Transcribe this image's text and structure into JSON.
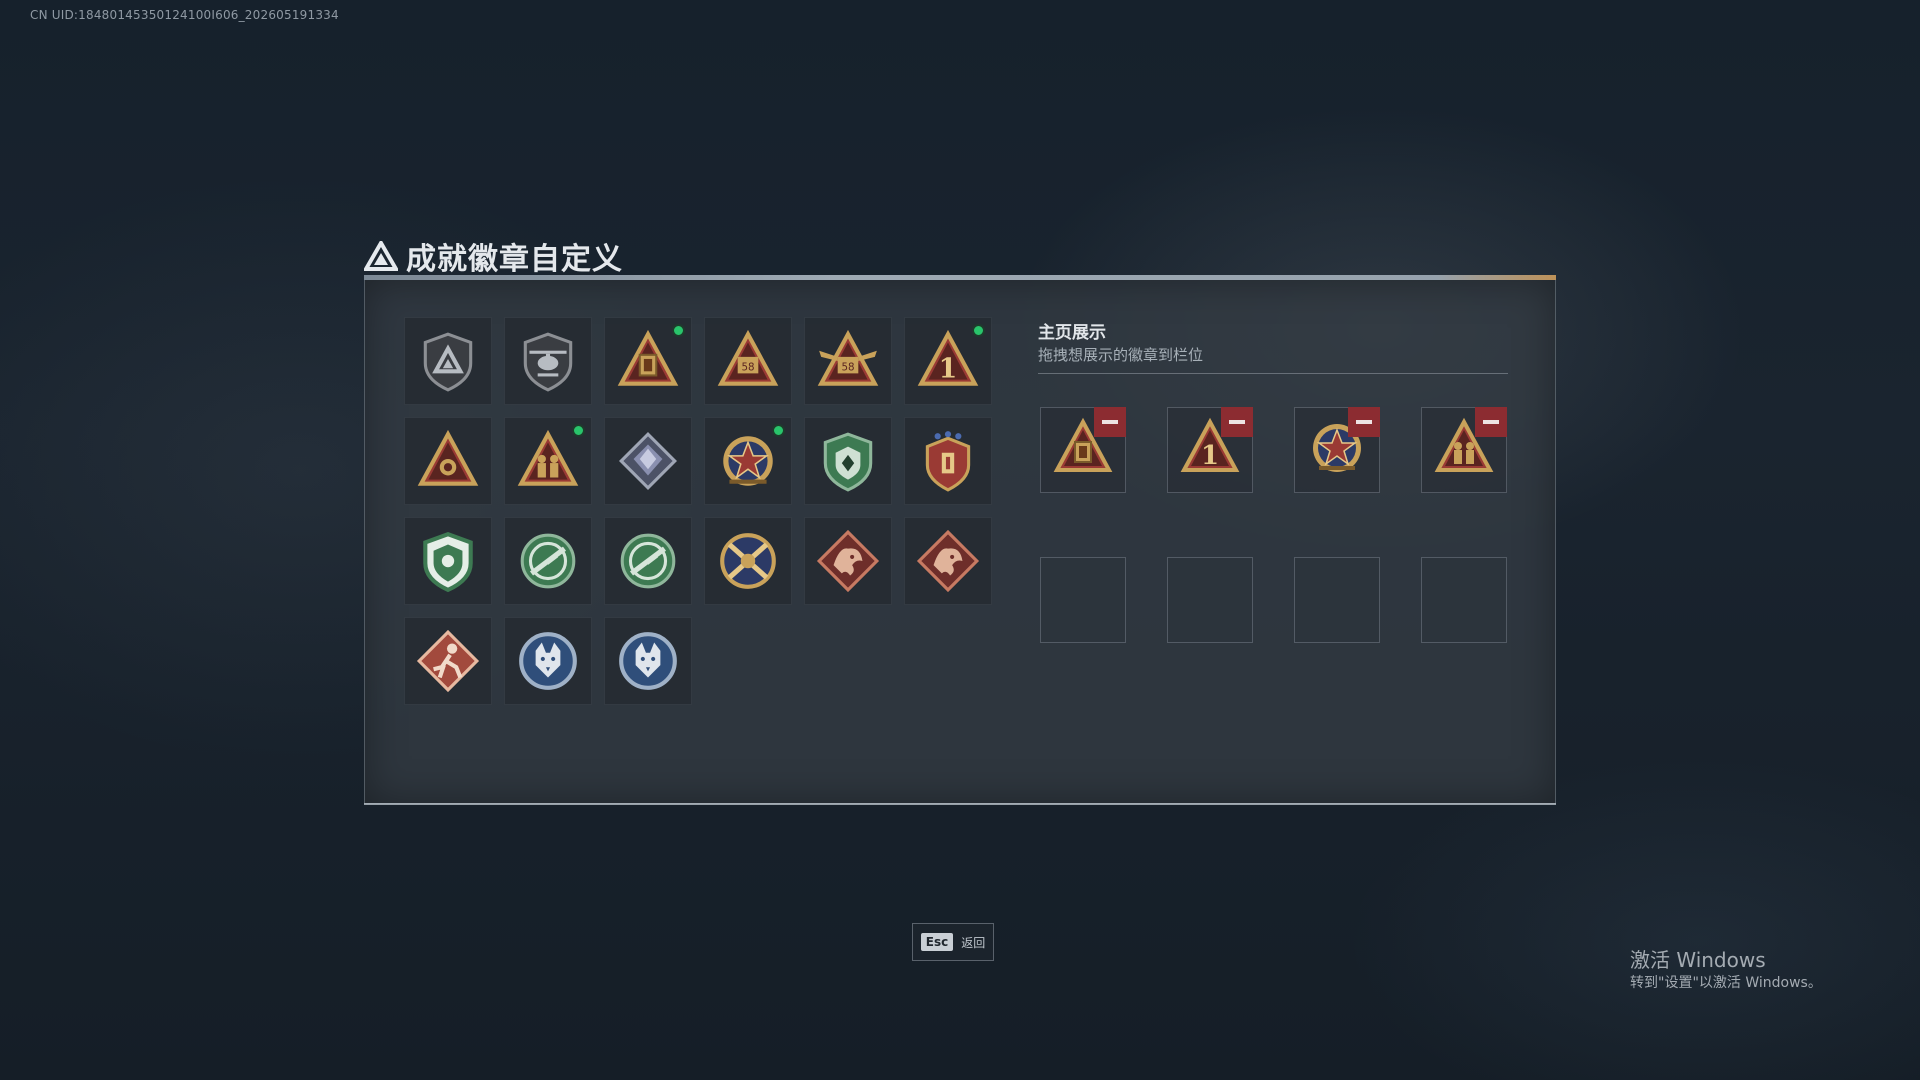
{
  "uid_text": "CN UID:18480145350124100I606_202605191334",
  "dialog": {
    "title": "成就徽章自定义",
    "title_icon": "tri-logo-icon"
  },
  "badges": [
    {
      "name": "badge-shield-delta",
      "new": false
    },
    {
      "name": "badge-helicopter",
      "new": false
    },
    {
      "name": "badge-gold-lantern",
      "new": true
    },
    {
      "name": "badge-gold-58",
      "new": false
    },
    {
      "name": "badge-gold-winged-58",
      "new": false
    },
    {
      "name": "badge-gold-one",
      "new": true
    },
    {
      "name": "badge-gold-gem",
      "new": false
    },
    {
      "name": "badge-gold-soldiers",
      "new": true
    },
    {
      "name": "badge-silver-diamond",
      "new": false
    },
    {
      "name": "badge-red-star-medal",
      "new": true
    },
    {
      "name": "badge-green-shield",
      "new": false
    },
    {
      "name": "badge-red-eagle-shield",
      "new": false
    },
    {
      "name": "badge-green-armor",
      "new": false
    },
    {
      "name": "badge-green-rifle-1",
      "new": false
    },
    {
      "name": "badge-green-rifle-2",
      "new": false
    },
    {
      "name": "badge-gold-cross-rifle",
      "new": false
    },
    {
      "name": "badge-red-dragon-1",
      "new": false
    },
    {
      "name": "badge-red-dragon-2",
      "new": false
    },
    {
      "name": "badge-red-runner",
      "new": false
    },
    {
      "name": "badge-wolf-1",
      "new": false
    },
    {
      "name": "badge-wolf-2",
      "new": false
    }
  ],
  "home_display": {
    "title": "主页展示",
    "subtitle": "拖拽想展示的徽章到栏位",
    "slots": [
      "badge-gold-lantern",
      "badge-gold-one",
      "badge-red-star-medal",
      "badge-gold-soldiers",
      "",
      "",
      "",
      ""
    ]
  },
  "esc_button": {
    "key": "Esc",
    "label": "返回"
  },
  "windows_activation": {
    "title": "激活 Windows",
    "subtitle": "转到\"设置\"以激活 Windows。"
  },
  "colors": {
    "new_dot": "#29c46b",
    "remove": "#8c2c31",
    "gold": "#c9a25a",
    "green": "#3d7a52",
    "red": "#9a3a34"
  }
}
